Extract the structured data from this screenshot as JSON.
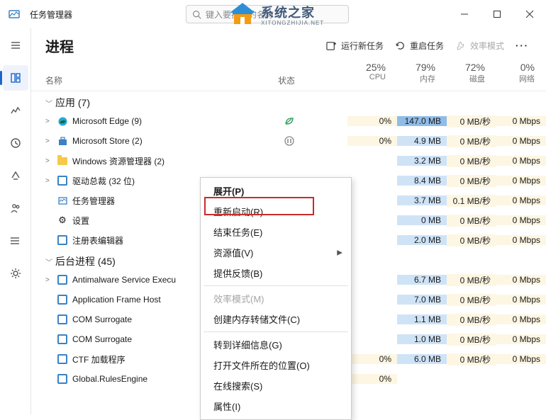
{
  "titlebar": {
    "title": "任务管理器",
    "search_placeholder": "键入要搜索的名称…"
  },
  "watermark": {
    "cn": "系统之家",
    "py": "XITONGZHIJIA.NET"
  },
  "header": {
    "page_title": "进程",
    "run_new_task": "运行新任务",
    "restart_task": "重启任务",
    "efficiency_mode": "效率模式"
  },
  "columns": {
    "name": "名称",
    "status": "状态",
    "cpu_pct": "25%",
    "cpu_lbl": "CPU",
    "mem_pct": "79%",
    "mem_lbl": "内存",
    "disk_pct": "72%",
    "disk_lbl": "磁盘",
    "net_pct": "0%",
    "net_lbl": "网络"
  },
  "groups": {
    "apps": "应用 (7)",
    "bg": "后台进程 (45)"
  },
  "rows": [
    {
      "exp": ">",
      "icon": "edge",
      "name": "Microsoft Edge (9)",
      "status": "leaf",
      "cpu": "0%",
      "mem": "147.0 MB",
      "mem_hl": "hi",
      "disk": "0 MB/秒",
      "net": "0 Mbps"
    },
    {
      "exp": ">",
      "icon": "store",
      "name": "Microsoft Store (2)",
      "status": "pause",
      "cpu": "0%",
      "mem": "4.9 MB",
      "disk": "0 MB/秒",
      "net": "0 Mbps"
    },
    {
      "exp": ">",
      "icon": "folder",
      "name": "Windows 资源管理器 (2)",
      "cpu": "",
      "mem": "3.2 MB",
      "disk": "0 MB/秒",
      "net": "0 Mbps"
    },
    {
      "exp": ">",
      "icon": "sq",
      "name": "驱动总裁 (32 位)",
      "cpu": "",
      "mem": "8.4 MB",
      "disk": "0 MB/秒",
      "net": "0 Mbps"
    },
    {
      "exp": "",
      "icon": "tm",
      "name": "任务管理器",
      "cpu": "",
      "mem": "3.7 MB",
      "disk": "0.1 MB/秒",
      "net": "0 Mbps"
    },
    {
      "exp": "",
      "icon": "gear",
      "name": "设置",
      "cpu": "",
      "mem": "0 MB",
      "disk": "0 MB/秒",
      "net": "0 Mbps"
    },
    {
      "exp": "",
      "icon": "sq",
      "name": "注册表编辑器",
      "cpu": "",
      "mem": "2.0 MB",
      "disk": "0 MB/秒",
      "net": "0 Mbps"
    }
  ],
  "bg_rows": [
    {
      "exp": ">",
      "icon": "sq",
      "name": "Antimalware Service Execu",
      "cpu": "",
      "mem": "6.7 MB",
      "disk": "0 MB/秒",
      "net": "0 Mbps"
    },
    {
      "exp": "",
      "icon": "sq",
      "name": "Application Frame Host",
      "cpu": "",
      "mem": "7.0 MB",
      "disk": "0 MB/秒",
      "net": "0 Mbps"
    },
    {
      "exp": "",
      "icon": "sq",
      "name": "COM Surrogate",
      "cpu": "",
      "mem": "1.1 MB",
      "disk": "0 MB/秒",
      "net": "0 Mbps"
    },
    {
      "exp": "",
      "icon": "sq",
      "name": "COM Surrogate",
      "cpu": "",
      "mem": "1.0 MB",
      "disk": "0 MB/秒",
      "net": "0 Mbps"
    },
    {
      "exp": "",
      "icon": "sq",
      "name": "CTF 加载程序",
      "cpu": "0%",
      "mem": "6.0 MB",
      "disk": "0 MB/秒",
      "net": "0 Mbps"
    },
    {
      "exp": "",
      "icon": "sq",
      "name": "Global.RulesEngine",
      "cpu": "0%",
      "mem": "",
      "disk": "",
      "net": ""
    }
  ],
  "ctx": {
    "expand": "展开(P)",
    "restart": "重新启动(R)",
    "end_task": "结束任务(E)",
    "resource": "资源值(V)",
    "feedback": "提供反馈(B)",
    "eff_mode": "效率模式(M)",
    "dump": "创建内存转储文件(C)",
    "details": "转到详细信息(G)",
    "open_loc": "打开文件所在的位置(O)",
    "search_online": "在线搜索(S)",
    "properties": "属性(I)"
  }
}
